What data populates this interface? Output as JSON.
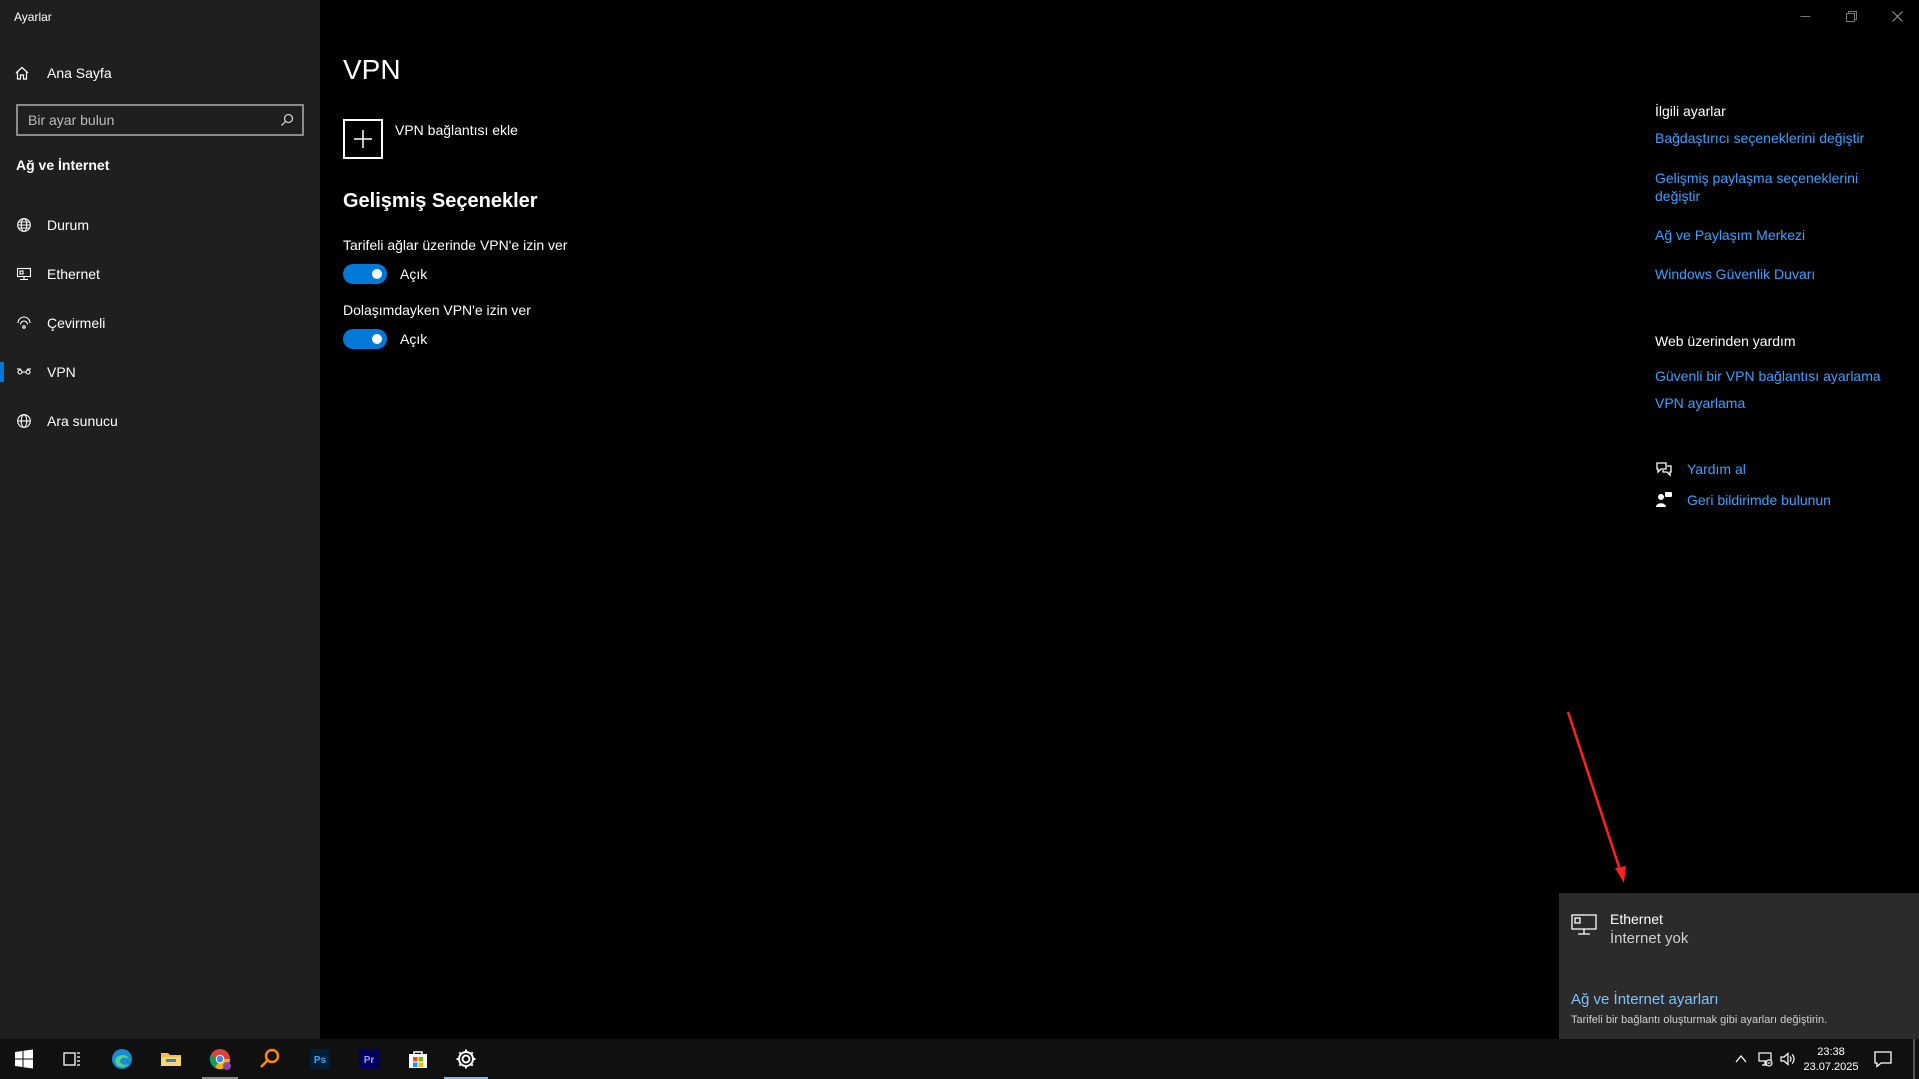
{
  "window": {
    "app_title": "Ayarlar",
    "controls": {
      "minimize": "minimize-icon",
      "restore": "restore-icon",
      "close": "close-icon"
    }
  },
  "sidebar": {
    "home_label": "Ana Sayfa",
    "search_placeholder": "Bir ayar bulun",
    "section_title": "Ağ ve İnternet",
    "items": [
      {
        "label": "Durum",
        "icon": "globe-status-icon"
      },
      {
        "label": "Ethernet",
        "icon": "ethernet-icon"
      },
      {
        "label": "Çevirmeli",
        "icon": "dialup-icon"
      },
      {
        "label": "VPN",
        "icon": "vpn-icon",
        "active": true
      },
      {
        "label": "Ara sunucu",
        "icon": "proxy-globe-icon"
      }
    ]
  },
  "main": {
    "title": "VPN",
    "add_vpn_label": "VPN bağlantısı ekle",
    "advanced_title": "Gelişmiş Seçenekler",
    "options": [
      {
        "label": "Tarifeli ağlar üzerinde VPN'e izin ver",
        "state": "Açık",
        "on": true
      },
      {
        "label": "Dolaşımdayken VPN'e izin ver",
        "state": "Açık",
        "on": true
      }
    ]
  },
  "right_pane": {
    "related_heading": "İlgili ayarlar",
    "related_links": [
      "Bağdaştırıcı seçeneklerini değiştir",
      "Gelişmiş paylaşma seçeneklerini değiştir",
      "Ağ ve Paylaşım Merkezi",
      "Windows Güvenlik Duvarı"
    ],
    "web_help_heading": "Web üzerinden yardım",
    "web_help_links": [
      "Güvenli bir VPN bağlantısı ayarlama",
      "VPN ayarlama"
    ],
    "help_label": "Yardım al",
    "feedback_label": "Geri bildirimde bulunun"
  },
  "flyout": {
    "network_name": "Ethernet",
    "network_status": "İnternet yok",
    "settings_link": "Ağ ve İnternet ayarları",
    "settings_desc": "Tarifeli bir bağlantı oluşturmak gibi ayarları değiştirin."
  },
  "taskbar": {
    "apps": [
      "start-icon",
      "task-view-icon",
      "edge-icon",
      "file-explorer-icon",
      "chrome-icon",
      "search-app-icon",
      "photoshop-icon",
      "premiere-icon",
      "store-icon",
      "settings-icon"
    ],
    "photoshop_label": "Ps",
    "premiere_label": "Pr",
    "time": "23:38",
    "date": "23.07.2025"
  },
  "colors": {
    "accent": "#0078d7",
    "link": "#3aa0ff",
    "annotation_arrow": "#ff2020"
  }
}
